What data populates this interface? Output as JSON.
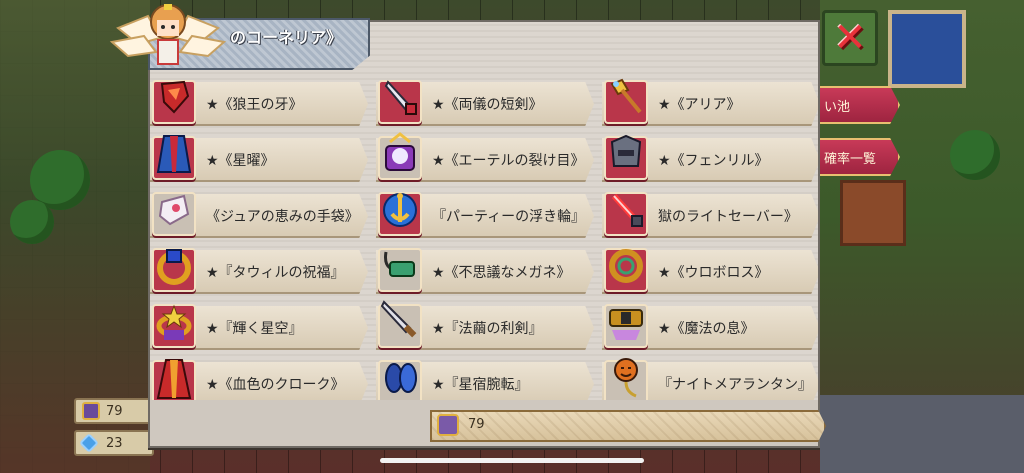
{
  "header": {
    "title": "のコーネリア》"
  },
  "side_tabs": [
    "い池",
    "確率一覧"
  ],
  "currency": [
    {
      "icon": "ticket-icon",
      "value": "79"
    },
    {
      "icon": "gem-icon",
      "value": "23"
    }
  ],
  "items": [
    {
      "name": "★《狼王の牙》",
      "icon": "fang-icon",
      "color": "#c82a2a"
    },
    {
      "name": "★《両儀の短剣》",
      "icon": "dagger-icon",
      "color": "#d8d8e0"
    },
    {
      "name": "★《アリア》",
      "icon": "staff-icon",
      "color": "#e0a030"
    },
    {
      "name": "★《星曜》",
      "icon": "cloak-icon",
      "color": "#2a5ab8"
    },
    {
      "name": "★《エーテルの裂け目》",
      "icon": "portal-icon",
      "color": "#8a3ab8"
    },
    {
      "name": "★《フェンリル》",
      "icon": "wolf-helm-icon",
      "color": "#6a7080"
    },
    {
      "name": "《ジュアの恵みの手袋》",
      "icon": "glove-icon",
      "color": "#f0e8f0"
    },
    {
      "name": "『パーティーの浮き輪』",
      "icon": "anchor-icon",
      "color": "#2a70d8"
    },
    {
      "name": "獄のライトセーバー》",
      "icon": "lightsaber-icon",
      "color": "#e02a2a"
    },
    {
      "name": "★『タウィルの祝福』",
      "icon": "ring-icon",
      "color": "#e0a020"
    },
    {
      "name": "★《不思議なメガネ》",
      "icon": "glasses-icon",
      "color": "#3aa070"
    },
    {
      "name": "★《ウロボロス》",
      "icon": "snake-icon",
      "color": "#d09020"
    },
    {
      "name": "★『輝く星空』",
      "icon": "star-ring-icon",
      "color": "#e0a020"
    },
    {
      "name": "★『法繭の利剣』",
      "icon": "sword-icon",
      "color": "#c8c8d0"
    },
    {
      "name": "★《魔法の息》",
      "icon": "belt-icon",
      "color": "#c89020"
    },
    {
      "name": "★《血色のクローク》",
      "icon": "red-cloak-icon",
      "color": "#c82a2a"
    },
    {
      "name": "★『星宿腕転』",
      "icon": "bracer-icon",
      "color": "#2a4aa8"
    },
    {
      "name": "『ナイトメアランタン』",
      "icon": "lantern-icon",
      "color": "#e07020"
    }
  ],
  "count": "79"
}
